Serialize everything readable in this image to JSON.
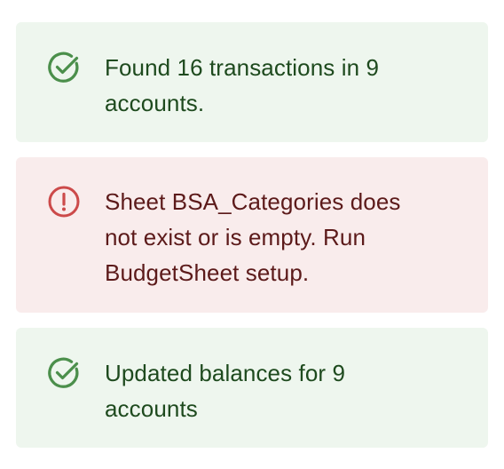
{
  "alerts": [
    {
      "type": "success",
      "icon": "check-circle-icon",
      "message": "Found 16 transactions in 9 accounts.",
      "accent_color": "#4b8f4b",
      "background_color": "#eef6ee"
    },
    {
      "type": "error",
      "icon": "exclamation-circle-icon",
      "message": "Sheet BSA_Categories does not exist or is empty. Run BudgetSheet setup.",
      "accent_color": "#cc4a4a",
      "background_color": "#f9ecec"
    },
    {
      "type": "success",
      "icon": "check-circle-icon",
      "message": "Updated balances for 9 accounts",
      "accent_color": "#4b8f4b",
      "background_color": "#eef6ee"
    }
  ]
}
